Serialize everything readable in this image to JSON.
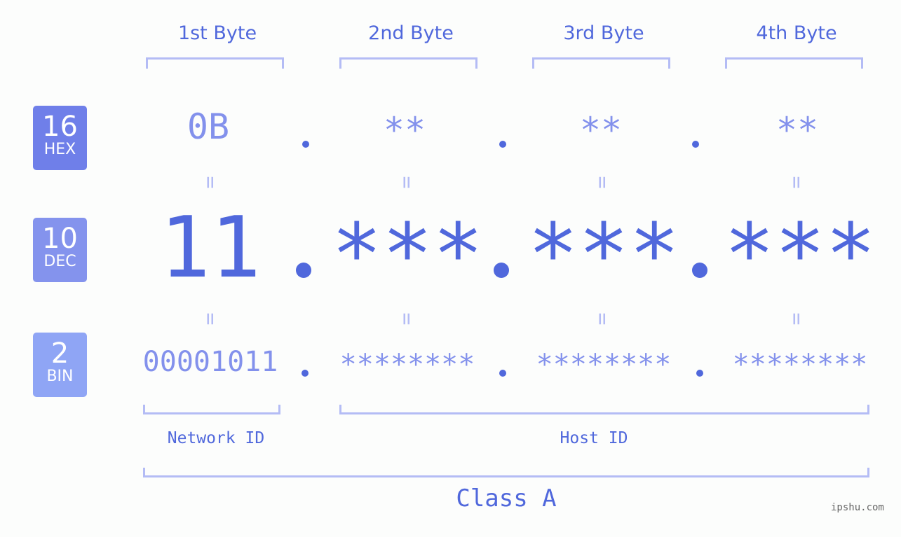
{
  "bytes": {
    "labels": [
      "1st Byte",
      "2nd Byte",
      "3rd Byte",
      "4th Byte"
    ]
  },
  "badges": {
    "hex": {
      "num": "16",
      "label": "HEX",
      "color": "#6f7fe9"
    },
    "dec": {
      "num": "10",
      "label": "DEC",
      "color": "#8493ed"
    },
    "bin": {
      "num": "2",
      "label": "BIN",
      "color": "#8fa5f5"
    }
  },
  "hex": [
    "0B",
    "**",
    "**",
    "**"
  ],
  "dec": [
    "11",
    "***",
    "***",
    "***"
  ],
  "bin": [
    "00001011",
    "********",
    "********",
    "********"
  ],
  "equals_sign": "=",
  "ids": {
    "network": "Network ID",
    "host": "Host ID"
  },
  "class_label": "Class A",
  "watermark": "ipshu.com"
}
